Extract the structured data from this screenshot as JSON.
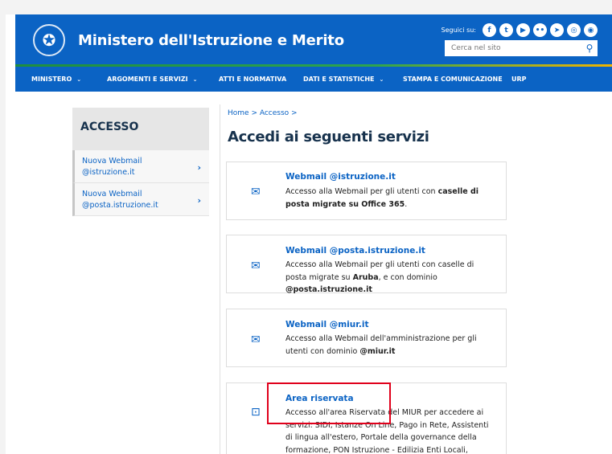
{
  "header": {
    "site_title": "Ministero dell'Istruzione e Merito",
    "social_label": "Seguici su:",
    "social_icons": [
      "facebook-icon",
      "twitter-icon",
      "youtube-icon",
      "flickr-icon",
      "telegram-icon",
      "instagram-icon",
      "podcast-icon"
    ],
    "search_placeholder": "Cerca nel sito"
  },
  "nav": {
    "items": [
      {
        "label": "MINISTERO",
        "chevron": true
      },
      {
        "label": "ARGOMENTI E SERVIZI",
        "chevron": true
      },
      {
        "label": "ATTI E NORMATIVA",
        "chevron": false
      },
      {
        "label": "DATI E STATISTICHE",
        "chevron": true
      },
      {
        "label": "STAMPA E COMUNICAZIONE",
        "chevron": false
      },
      {
        "label": "URP",
        "chevron": false
      }
    ]
  },
  "sidebar": {
    "title": "ACCESSO",
    "items": [
      {
        "line1": "Nuova Webmail",
        "line2": "@istruzione.it"
      },
      {
        "line1": "Nuova Webmail",
        "line2": "@posta.istruzione.it"
      }
    ]
  },
  "main": {
    "breadcrumb": "Home > Accesso >",
    "title": "Accedi ai seguenti servizi",
    "cards": [
      {
        "title": "Webmail @istruzione.it",
        "icon": "envelope-icon",
        "desc_parts": [
          [
            "Accesso alla Webmail per gli utenti con ",
            false
          ],
          [
            "caselle di posta migrate su Office 365",
            true
          ],
          [
            ".",
            false
          ]
        ]
      },
      {
        "title": "Webmail @posta.istruzione.it",
        "icon": "envelope-icon",
        "desc_parts": [
          [
            "Accesso alla Webmail per gli utenti con caselle di posta migrate su ",
            false
          ],
          [
            "Aruba",
            true
          ],
          [
            ", e con dominio ",
            false
          ],
          [
            "@posta.istruzione.it",
            true
          ]
        ]
      },
      {
        "title": "Webmail @miur.it",
        "icon": "envelope-icon",
        "desc_parts": [
          [
            "Accesso alla Webmail dell'amministrazione per gli utenti con dominio ",
            false
          ],
          [
            "@miur.it",
            true
          ]
        ]
      },
      {
        "title": "Area riservata",
        "icon": "lock-icon",
        "desc_parts": [
          [
            "Accesso all'area Riservata del MIUR per accedere ai servizi: SIDI, Istanze On Line, Pago in Rete, Assistenti di lingua all'estero, Portale della governance della formazione, PON Istruzione - Edilizia Enti Locali, Edilizia",
            false
          ]
        ]
      }
    ]
  },
  "colors": {
    "brand_blue": "#0b63c4",
    "highlight_red": "#e0001b"
  }
}
